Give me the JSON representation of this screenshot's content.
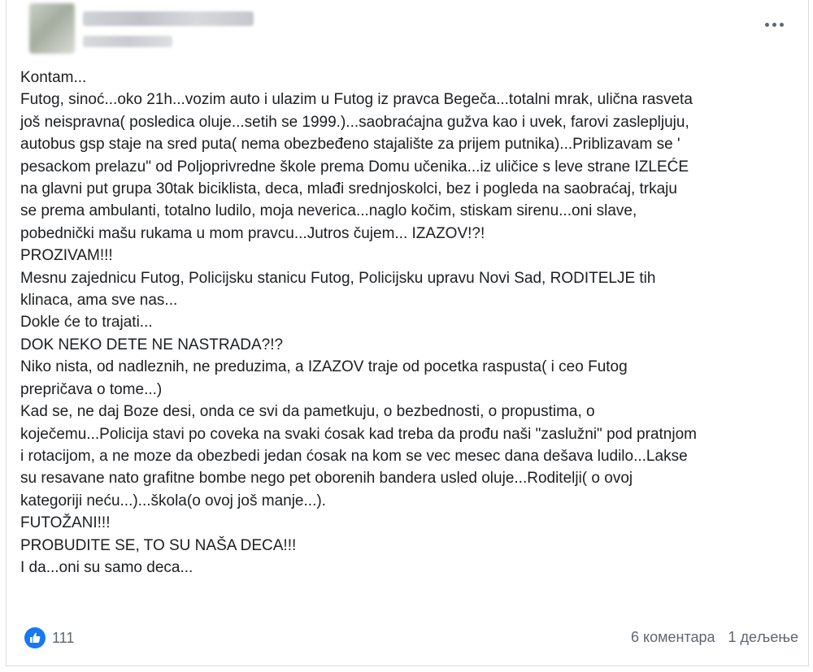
{
  "post": {
    "menu_icon": "more-horizontal-icon",
    "body_lines": [
      "Kontam...",
      "Futog, sinoć...oko 21h...vozim auto i ulazim u Futog iz pravca Begeča...totalni mrak, ulična rasveta",
      "još neispravna( posledica oluje...setih se 1999.)...saobraćajna gužva kao i uvek, farovi zaslepljuju,",
      "autobus gsp staje na sred puta( nema obezbeđeno stajalište za prijem putnika)...Priblizavam se '",
      "pesackom prelazu\" od Poljoprivredne škole prema Domu učenika...iz uličice s leve strane IZLEĆE",
      "na glavni put grupa 30tak biciklista, deca, mlađi srednjoskolci, bez i pogleda na saobraćaj, trkaju",
      "se prema ambulanti, totalno ludilo, moja neverica...naglo kočim, stiskam sirenu...oni slave,",
      "pobednički mašu rukama u mom pravcu...Jutros čujem... IZAZOV!?!",
      "PROZIVAM!!!",
      "Mesnu zajednicu Futog, Policijsku stanicu Futog, Policijsku upravu Novi Sad, RODITELJE tih",
      "klinaca, ama sve nas...",
      "Dokle će to trajati...",
      "DOK NEKO DETE NE NASTRADA?!?",
      "Niko nista, od nadleznih, ne preduzima, a IZAZOV traje od pocetka raspusta( i ceo Futog",
      "prepričava o tome...)",
      "Kad se, ne daj Boze desi, onda ce svi da pametkuju, o bezbednosti, o propustima, o",
      "koječemu...Policija stavi po coveka na svaki ćosak kad treba da prođu naši \"zaslužni\" pod pratnjom",
      "i rotacijom, a ne moze da obezbedi jedan ćosak na kom se vec mesec dana dešava ludilo...Lakse",
      "su resavane nato grafitne bombe nego pet oborenih bandera usled oluje...Roditelji( o ovoj",
      "kategoriji neću...)...škola(o ovoj još manje...).",
      "FUTOŽANI!!!",
      "PROBUDITE SE, TO SU NAŠA DECA!!!",
      "I da...oni su samo deca..."
    ]
  },
  "footer": {
    "like_icon": "thumbs-up-icon",
    "like_color": "#1877f2",
    "reaction_count": "111",
    "comments": "6 коментара",
    "shares": "1 дељење"
  }
}
